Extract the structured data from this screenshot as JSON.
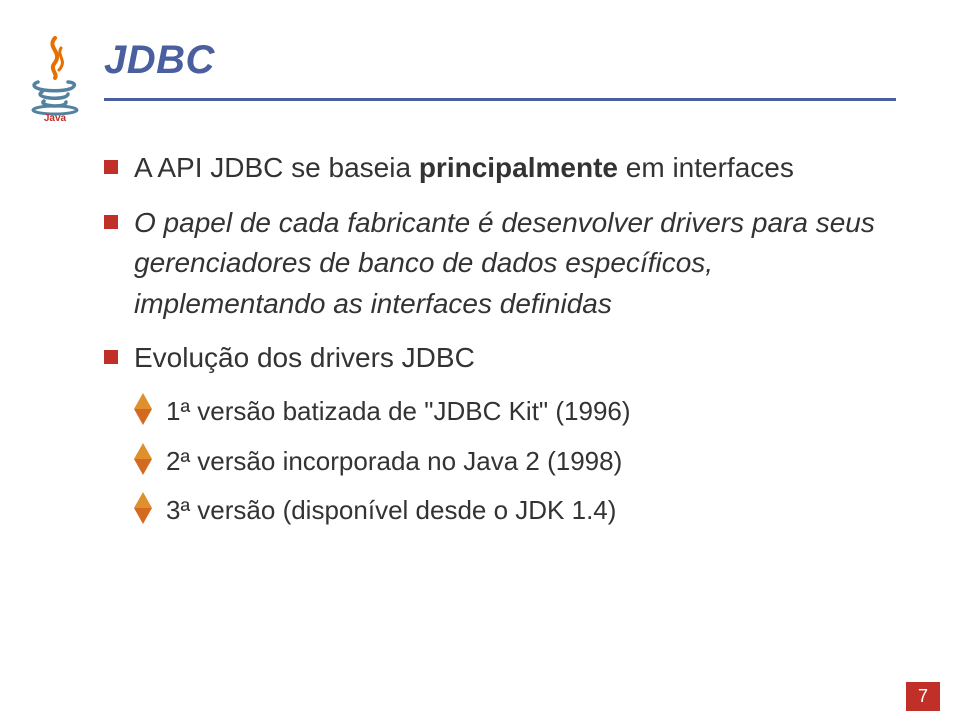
{
  "title": "JDBC",
  "bullets": [
    {
      "prefix": "A API JDBC se baseia ",
      "emph": "principalmente",
      "suffix": " em interfaces"
    },
    {
      "text": "O papel de cada fabricante é desenvolver drivers para seus gerenciadores de banco de dados específicos, implementando as interfaces definidas"
    },
    {
      "text": "Evolução dos drivers JDBC",
      "sub": [
        "1ª versão batizada de \"JDBC Kit\" (1996)",
        "2ª versão incorporada no Java 2 (1998)",
        "3ª versão (disponível desde o JDK 1.4)"
      ]
    }
  ],
  "page": "7",
  "logo_label": "Java"
}
